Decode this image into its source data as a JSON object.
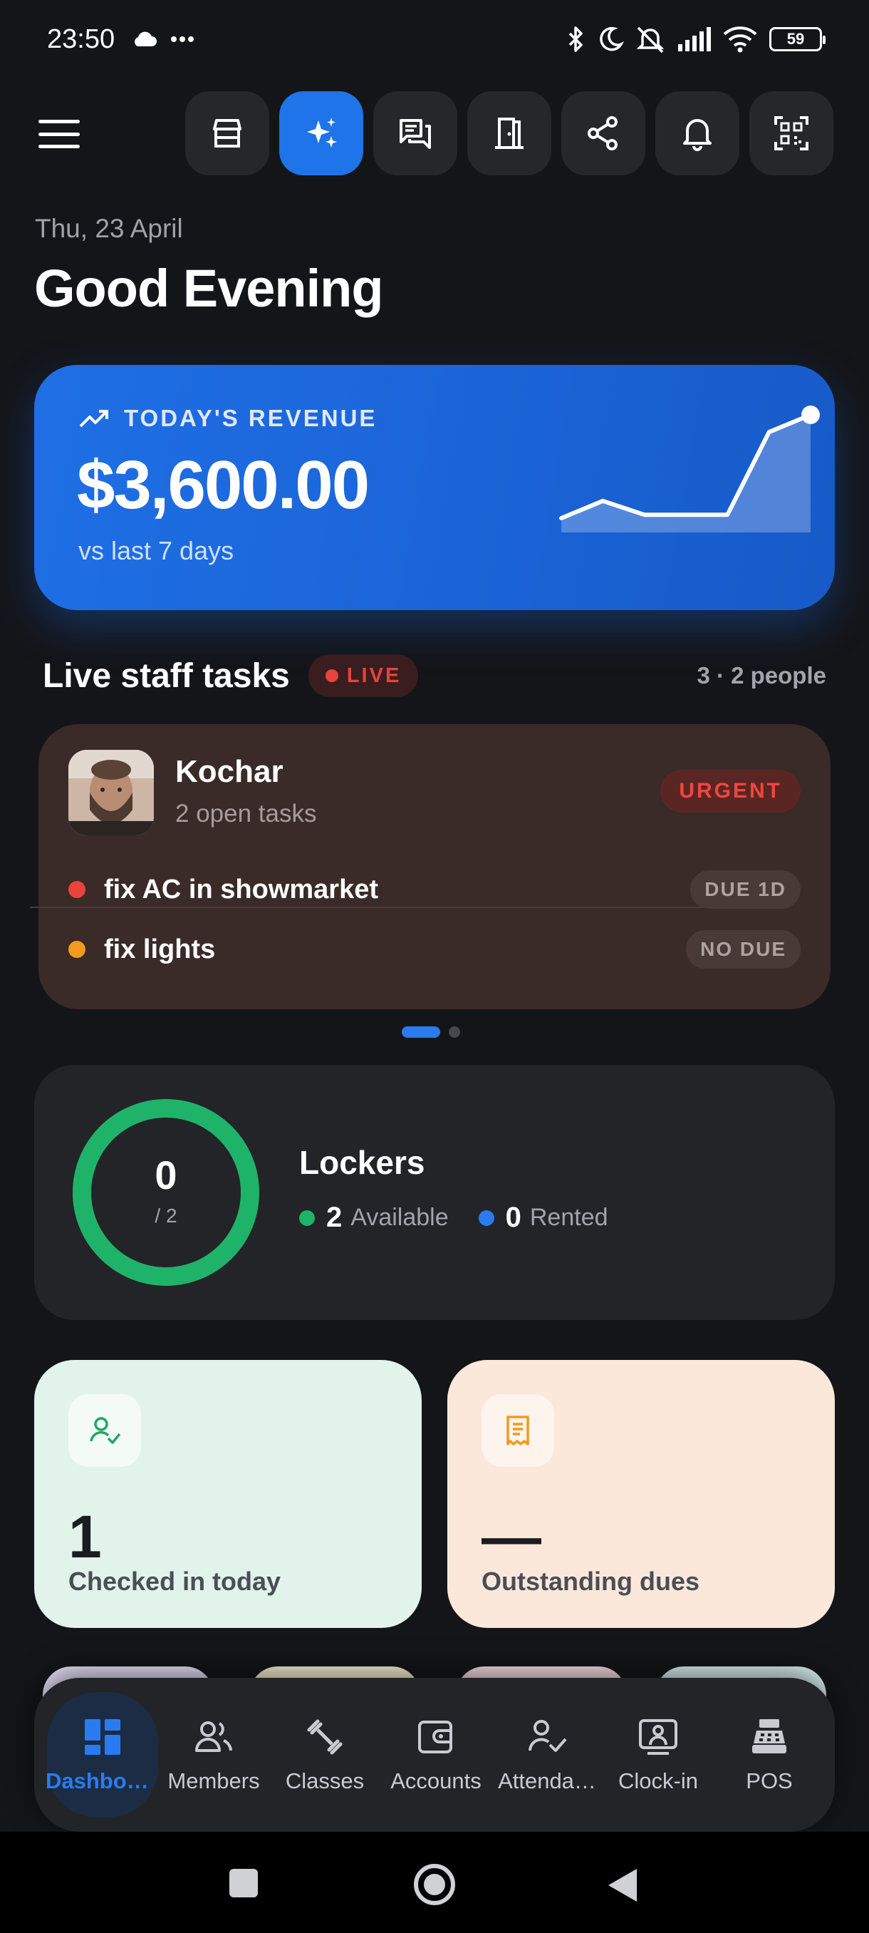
{
  "status_bar": {
    "time": "23:50",
    "battery": "59"
  },
  "colors": {
    "accent": "#1e74e8",
    "live_red": "#e8433c",
    "available_green": "#1fb36a",
    "rented_blue": "#2a7bf0",
    "urgent_red": "#f0463e",
    "orange": "#f29a1f"
  },
  "toolbar": {
    "icons": [
      "menu-icon",
      "store-icon",
      "sparkles-icon",
      "chat-icon",
      "door-icon",
      "share-icon",
      "bell-icon",
      "qr-code-icon"
    ],
    "active": "sparkles-icon"
  },
  "header": {
    "date": "Thu, 23 April",
    "greeting": "Good Evening"
  },
  "revenue": {
    "label": "TODAY'S REVENUE",
    "amount": "$3,600.00",
    "comparison": "vs last 7 days",
    "trend_values": [
      0,
      600,
      120,
      120,
      120,
      3000,
      3600
    ]
  },
  "tasks": {
    "title": "Live staff tasks",
    "live_label": "LIVE",
    "count": "3 · 2 people",
    "card": {
      "name": "Kochar",
      "subtitle": "2 open tasks",
      "priority": "URGENT",
      "items": [
        {
          "text": "fix AC in showmarket",
          "due": "DUE 1D",
          "dot": "red"
        },
        {
          "text": "fix lights",
          "due": "NO DUE",
          "dot": "orange"
        }
      ]
    },
    "pager": {
      "pages": 2,
      "current": 1
    }
  },
  "lockers": {
    "title": "Lockers",
    "rented": "0",
    "total": "/ 2",
    "available_count": "2",
    "available_label": "Available",
    "rented_count": "0",
    "rented_label": "Rented",
    "available_fraction": 1.0
  },
  "tiles": {
    "checked_in": {
      "value": "1",
      "label": "Checked in today",
      "icon": "user-check-icon"
    },
    "dues": {
      "value": "—",
      "label": "Outstanding dues",
      "icon": "receipt-icon"
    }
  },
  "bottom_nav": {
    "items": [
      {
        "label": "Dashboa…",
        "icon": "dashboard-icon",
        "active": true
      },
      {
        "label": "Members",
        "icon": "members-icon",
        "active": false
      },
      {
        "label": "Classes",
        "icon": "dumbbell-icon",
        "active": false
      },
      {
        "label": "Accounts",
        "icon": "wallet-icon",
        "active": false
      },
      {
        "label": "Attenda…",
        "icon": "attendance-icon",
        "active": false
      },
      {
        "label": "Clock-in",
        "icon": "clock-in-icon",
        "active": false
      },
      {
        "label": "POS",
        "icon": "cash-register-icon",
        "active": false
      }
    ]
  }
}
